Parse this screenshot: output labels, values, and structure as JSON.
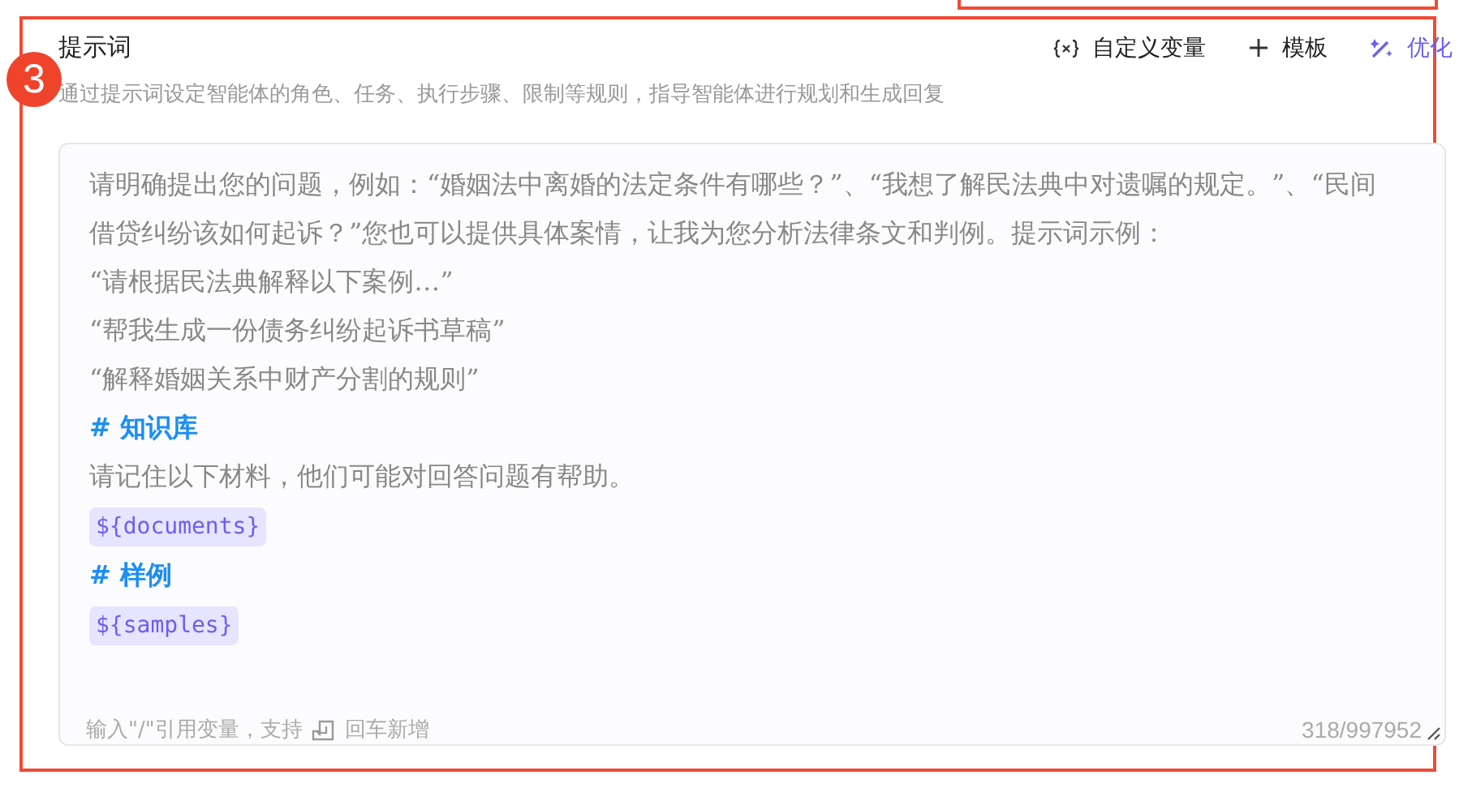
{
  "badge": "3",
  "title": "提示词",
  "actions": [
    {
      "kind": "variable",
      "label": "自定义变量"
    },
    {
      "kind": "template",
      "label": "模板"
    },
    {
      "kind": "optimize",
      "label": "优化"
    }
  ],
  "description": "通过提示词设定智能体的角色、任务、执行步骤、限制等规则，指导智能体进行规划和生成回复",
  "prompt_lines": [
    {
      "kind": "text",
      "text": "请明确提出您的问题，例如：“婚姻法中离婚的法定条件有哪些？”、“我想了解民法典中对遗嘱的规定。”、“民间借贷纠纷该如何起诉？”您也可以提供具体案情，让我为您分析法律条文和判例。提示词示例："
    },
    {
      "kind": "text",
      "text": "“请根据民法典解释以下案例…”"
    },
    {
      "kind": "text",
      "text": "“帮我生成一份债务纠纷起诉书草稿”"
    },
    {
      "kind": "text",
      "text": "“解释婚姻关系中财产分割的规则”"
    },
    {
      "kind": "heading",
      "text": "# 知识库"
    },
    {
      "kind": "text",
      "text": "请记住以下材料，他们可能对回答问题有帮助。"
    },
    {
      "kind": "variable",
      "text": "${documents}"
    },
    {
      "kind": "heading",
      "text": "# 样例"
    },
    {
      "kind": "variable",
      "text": "${samples}"
    }
  ],
  "hint_before": "输入\"/\"引用变量，支持",
  "hint_after": "回车新增",
  "count": "318/997952"
}
